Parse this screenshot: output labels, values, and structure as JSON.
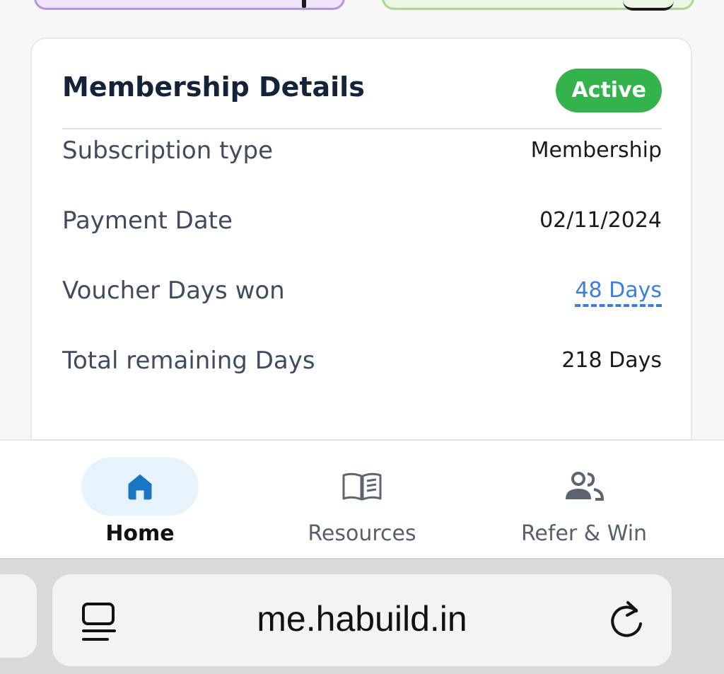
{
  "card": {
    "title": "Membership Details",
    "status_badge": "Active",
    "rows": [
      {
        "label": "Subscription type",
        "value": "Membership"
      },
      {
        "label": "Payment Date",
        "value": "02/11/2024"
      },
      {
        "label": "Voucher Days won",
        "value": "48 Days"
      },
      {
        "label": "Total remaining Days",
        "value": "218 Days"
      }
    ]
  },
  "nav": {
    "items": [
      {
        "label": "Home",
        "icon": "home-icon",
        "active": true
      },
      {
        "label": "Resources",
        "icon": "book-icon"
      },
      {
        "label": "Refer & Win",
        "icon": "users-icon"
      }
    ]
  },
  "browser": {
    "url": "me.habuild.in"
  },
  "colors": {
    "accent": "#34b24c",
    "link": "#3b7ee0",
    "home_icon": "#1a76c1"
  }
}
